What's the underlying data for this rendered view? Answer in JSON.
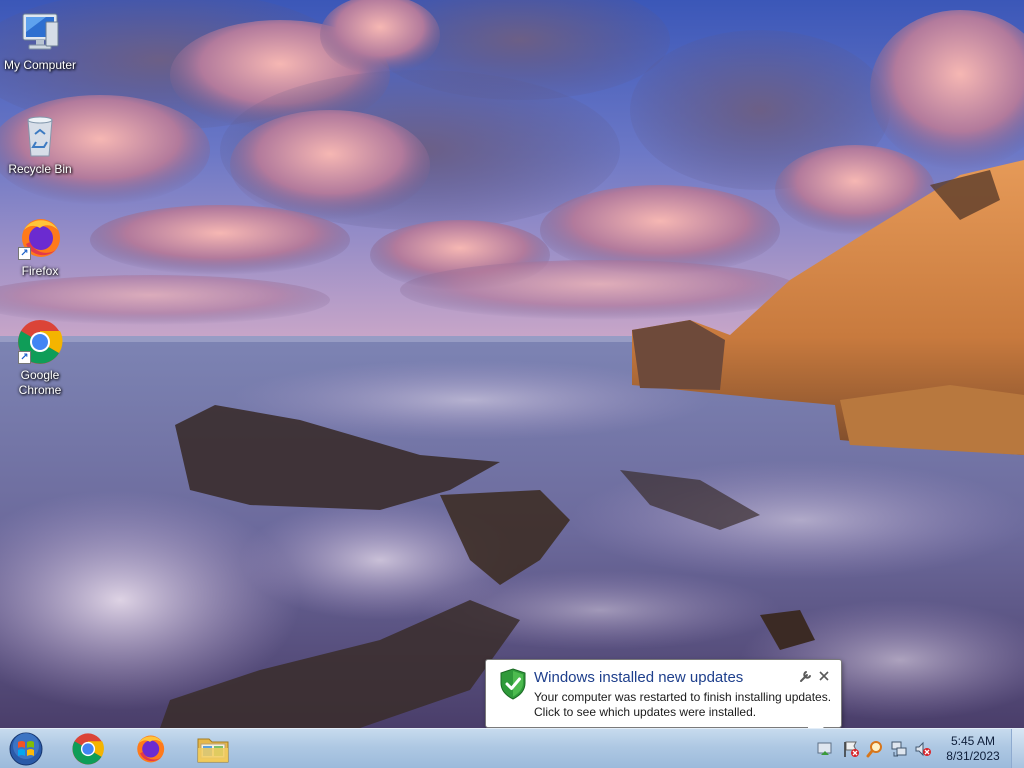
{
  "desktop": {
    "icons": [
      {
        "label": "My Computer",
        "icon": "computer-icon"
      },
      {
        "label": "Recycle Bin",
        "icon": "recycle-bin-icon"
      },
      {
        "label": "Firefox",
        "icon": "firefox-icon"
      },
      {
        "label": "Google\nChrome",
        "icon": "chrome-icon"
      }
    ]
  },
  "notification": {
    "title": "Windows installed new updates",
    "body": "Your computer was restarted to finish installing updates.\nClick to see which updates were installed.",
    "icon": "shield-check-icon",
    "options_icon": "wrench-icon",
    "close_icon": "close-icon",
    "title_color": "#1e3f8c"
  },
  "taskbar": {
    "start_icon": "windows-start-icon",
    "pinned": [
      {
        "name": "Google Chrome",
        "icon": "chrome-icon"
      },
      {
        "name": "Firefox",
        "icon": "firefox-icon"
      },
      {
        "name": "Windows Explorer",
        "icon": "folder-icon"
      }
    ],
    "tray": [
      {
        "icon": "windows-update-icon"
      },
      {
        "icon": "action-center-flag-icon"
      },
      {
        "icon": "search-magnifier-icon"
      },
      {
        "icon": "network-icon"
      },
      {
        "icon": "volume-muted-icon"
      }
    ],
    "clock": {
      "time": "5:45 AM",
      "date": "8/31/2023"
    }
  }
}
